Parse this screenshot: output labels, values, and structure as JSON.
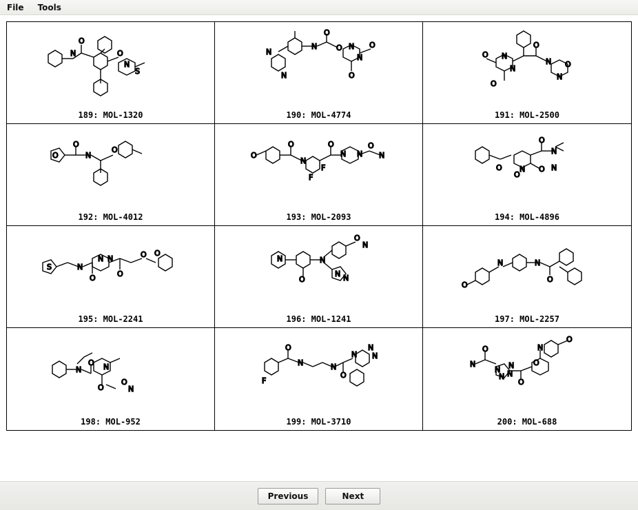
{
  "menu": {
    "file": "File",
    "tools": "Tools"
  },
  "molecules": [
    {
      "index": 189,
      "id": "MOL-1320",
      "caption": "189: MOL-1320"
    },
    {
      "index": 190,
      "id": "MOL-4774",
      "caption": "190: MOL-4774"
    },
    {
      "index": 191,
      "id": "MOL-2500",
      "caption": "191: MOL-2500"
    },
    {
      "index": 192,
      "id": "MOL-4012",
      "caption": "192: MOL-4012"
    },
    {
      "index": 193,
      "id": "MOL-2093",
      "caption": "193: MOL-2093"
    },
    {
      "index": 194,
      "id": "MOL-4896",
      "caption": "194: MOL-4896"
    },
    {
      "index": 195,
      "id": "MOL-2241",
      "caption": "195: MOL-2241"
    },
    {
      "index": 196,
      "id": "MOL-1241",
      "caption": "196: MOL-1241"
    },
    {
      "index": 197,
      "id": "MOL-2257",
      "caption": "197: MOL-2257"
    },
    {
      "index": 198,
      "id": "MOL-952",
      "caption": "198: MOL-952"
    },
    {
      "index": 199,
      "id": "MOL-3710",
      "caption": "199: MOL-3710"
    },
    {
      "index": 200,
      "id": "MOL-688",
      "caption": "200: MOL-688"
    }
  ],
  "footer": {
    "previous": "Previous",
    "next": "Next"
  }
}
